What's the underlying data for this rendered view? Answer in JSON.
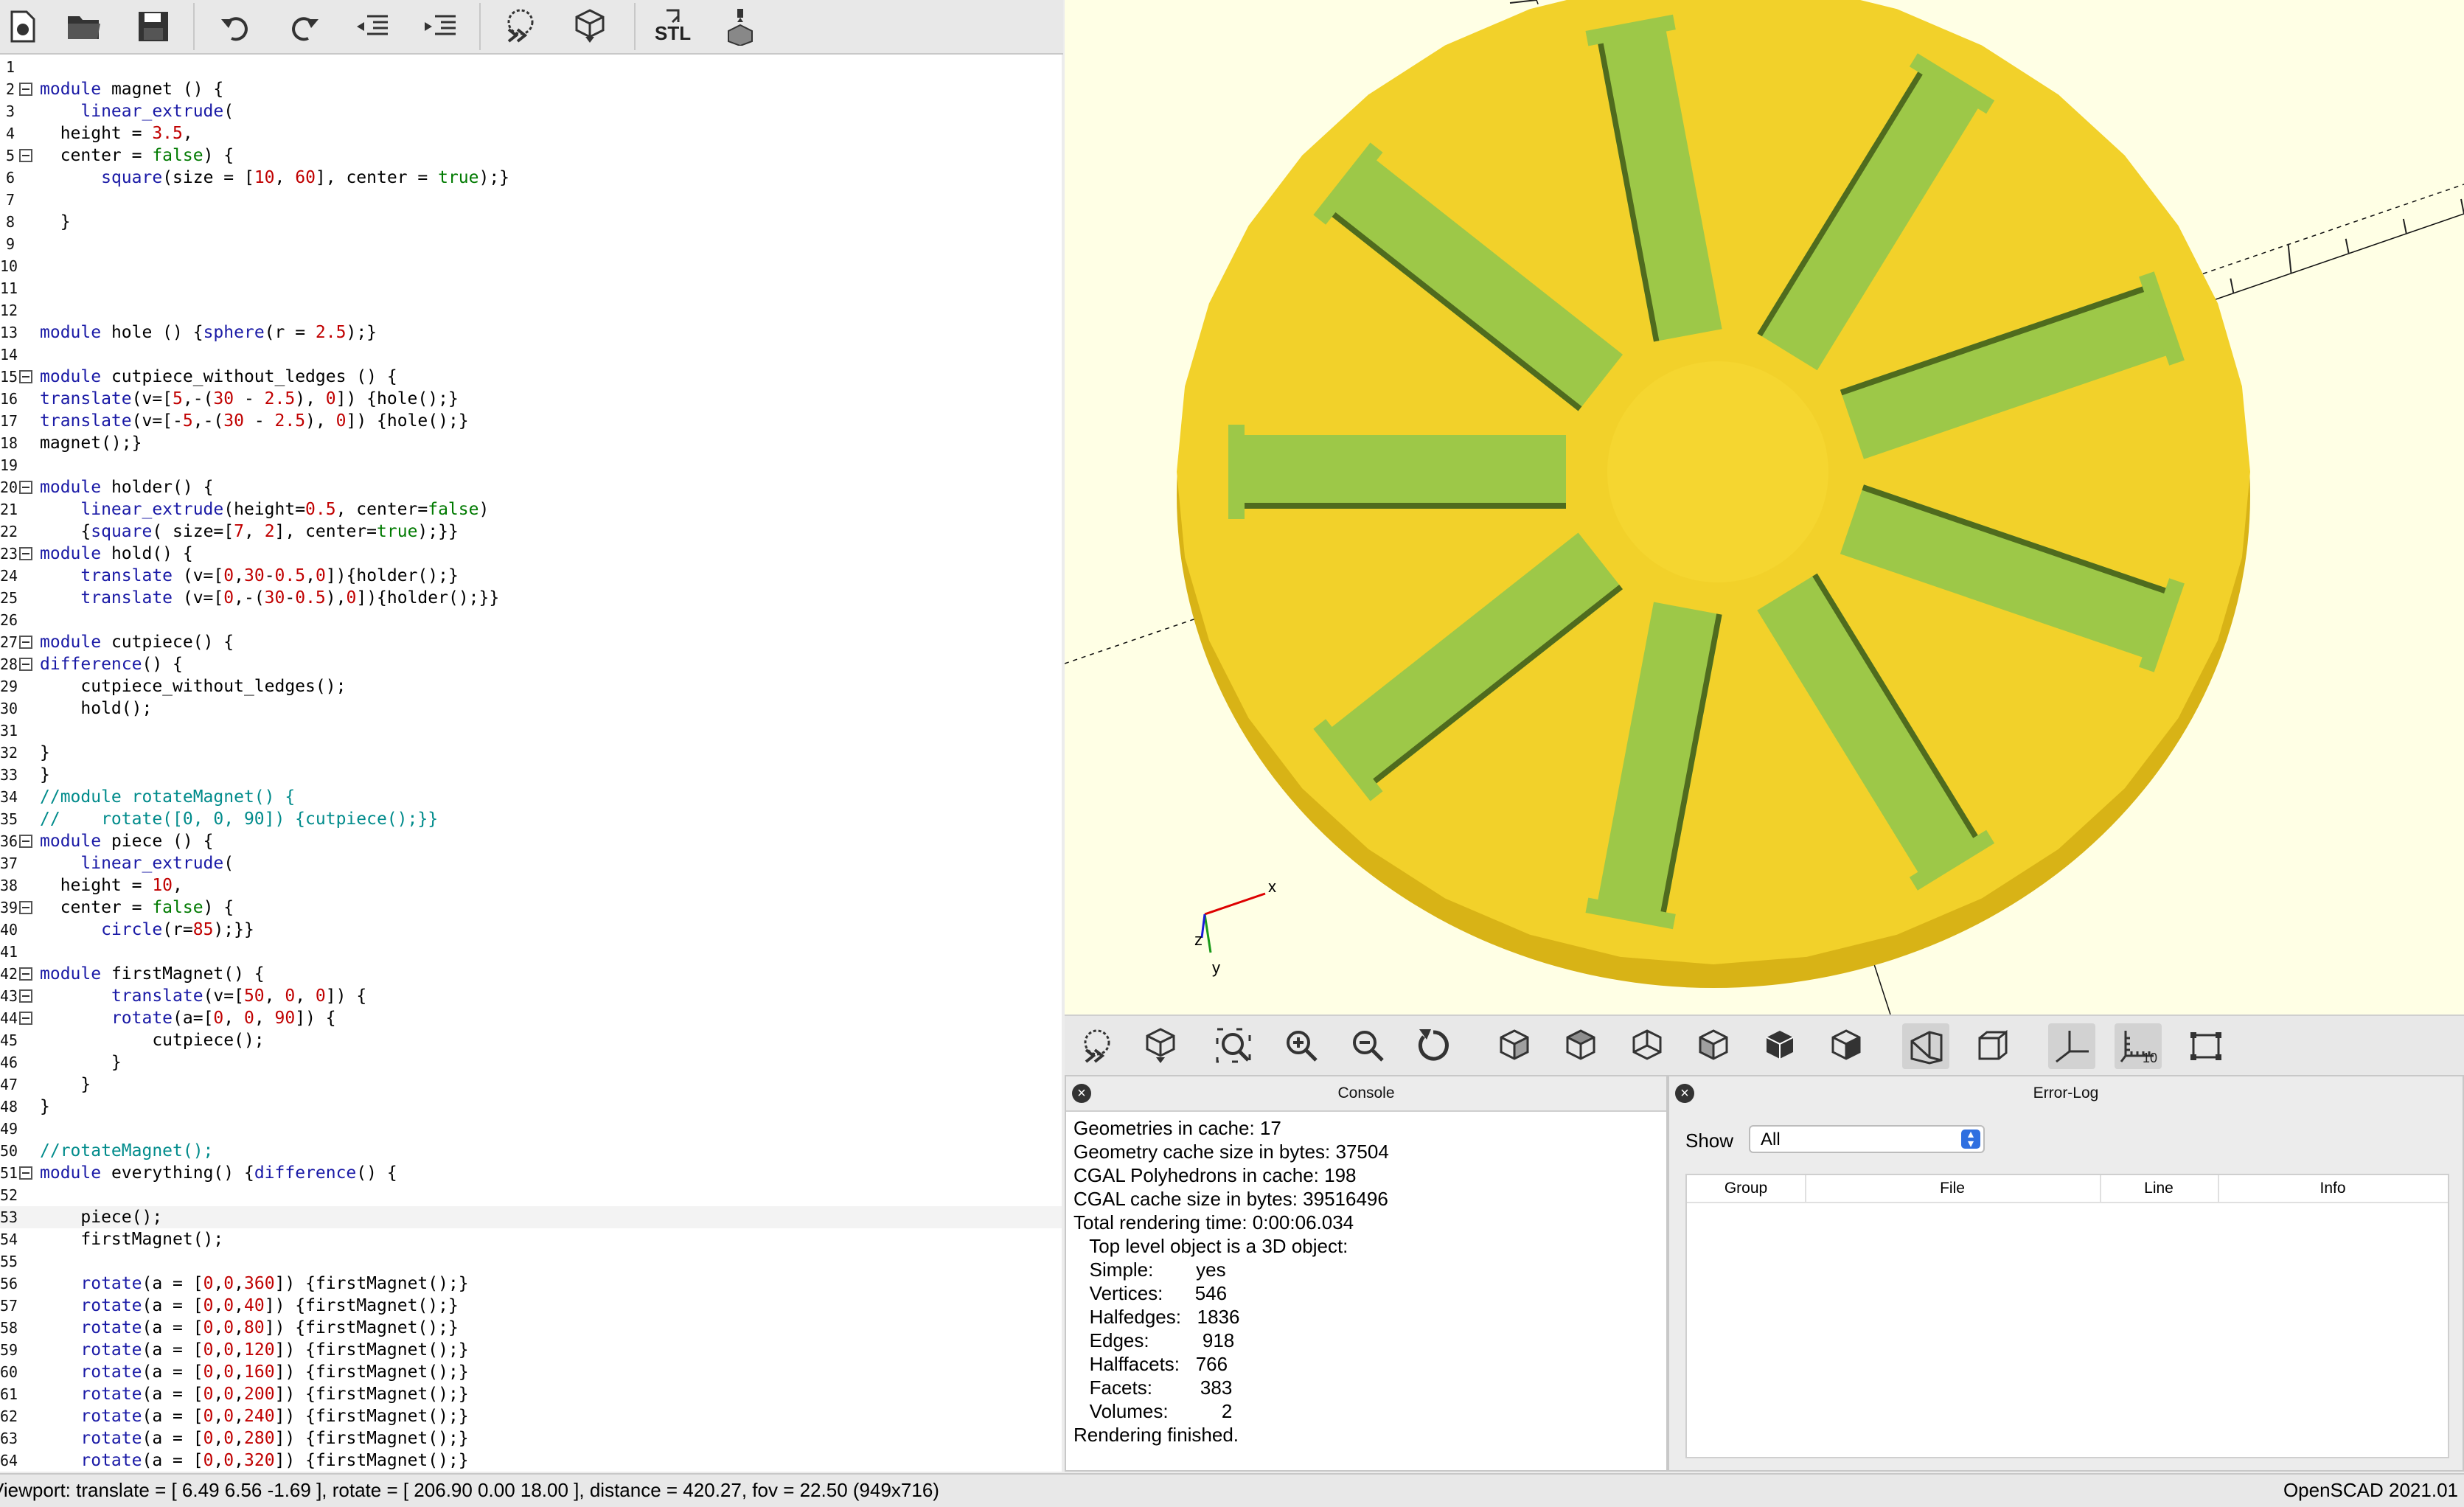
{
  "app": {
    "name_version": "OpenSCAD 2021.01"
  },
  "editor_toolbar": {
    "buttons": [
      "new-file",
      "open-file",
      "save-file",
      "undo",
      "redo",
      "unindent",
      "indent",
      "preview",
      "render",
      "export-stl",
      "send-to-3d-print"
    ],
    "stl_label": "STL"
  },
  "editor": {
    "lines": [
      "",
      "module magnet () {",
      "    linear_extrude(",
      "  height = 3.5,",
      "  center = false) {",
      "      square(size = [10, 60], center = true);}",
      "",
      "  }",
      "",
      "",
      "",
      "",
      "module hole () {sphere(r = 2.5);}",
      "",
      "module cutpiece_without_ledges () {",
      "translate(v=[5,-(30 - 2.5), 0]) {hole();}",
      "translate(v=[-5,-(30 - 2.5), 0]) {hole();}",
      "magnet();}",
      "",
      "module holder() {",
      "    linear_extrude(height=0.5, center=false)",
      "    {square( size=[7, 2], center=true);}}",
      "module hold() {",
      "    translate (v=[0,30-0.5,0]){holder();}",
      "    translate (v=[0,-(30-0.5),0]){holder();}}",
      "",
      "module cutpiece() {",
      "difference() {",
      "    cutpiece_without_ledges();",
      "    hold();",
      "",
      "}",
      "}",
      "//module rotateMagnet() {",
      "//    rotate([0, 0, 90]) {cutpiece();}}",
      "module piece () {",
      "    linear_extrude(",
      "  height = 10,",
      "  center = false) {",
      "      circle(r=85);}}",
      "",
      "module firstMagnet() {",
      "       translate(v=[50, 0, 0]) {",
      "       rotate(a=[0, 0, 90]) {",
      "           cutpiece();",
      "       }",
      "    }",
      "}",
      "",
      "//rotateMagnet();",
      "module everything() {difference() {",
      "",
      "    piece();",
      "    firstMagnet();",
      "",
      "    rotate(a = [0,0,360]) {firstMagnet();}",
      "    rotate(a = [0,0,40]) {firstMagnet();}",
      "    rotate(a = [0,0,80]) {firstMagnet();}",
      "    rotate(a = [0,0,120]) {firstMagnet();}",
      "    rotate(a = [0,0,160]) {firstMagnet();}",
      "    rotate(a = [0,0,200]) {firstMagnet();}",
      "    rotate(a = [0,0,240]) {firstMagnet();}",
      "    rotate(a = [0,0,280]) {firstMagnet();}",
      "    rotate(a = [0,0,320]) {firstMagnet();}"
    ],
    "line_numbers": [
      "1",
      "2",
      "3",
      "4",
      "5",
      "6",
      "7",
      "8",
      "9",
      "10",
      "11",
      "12",
      "13",
      "14",
      "15",
      "16",
      "17",
      "18",
      "19",
      "20",
      "21",
      "22",
      "23",
      "24",
      "25",
      "26",
      "27",
      "28",
      "29",
      "30",
      "31",
      "32",
      "33",
      "34",
      "35",
      "36",
      "37",
      "38",
      "39",
      "40",
      "41",
      "42",
      "43",
      "44",
      "45",
      "46",
      "47",
      "48",
      "49",
      "50",
      "51",
      "52",
      "53",
      "54",
      "55",
      "56",
      "57",
      "58",
      "59",
      "60",
      "61",
      "62",
      "63",
      "64"
    ],
    "fold_markers_at": [
      2,
      5,
      15,
      20,
      23,
      27,
      28,
      36,
      39,
      42,
      43,
      44,
      51
    ],
    "current_line": 53
  },
  "viewport": {
    "colors": {
      "background": "#ffffe5",
      "disk_top": "#f2d12a",
      "disk_side": "#d8b316",
      "slot_floor": "#9dc848",
      "slot_wall": "#4f6b1e"
    },
    "slot_count": 9,
    "slot_rotations_deg": [
      0,
      40,
      80,
      120,
      160,
      200,
      240,
      280,
      320
    ],
    "axis_label_x": "x",
    "axis_label_y": "y",
    "axis_label_z": "z"
  },
  "view_toolbar": {
    "buttons": [
      "preview",
      "render",
      "view-all",
      "zoom-in",
      "zoom-out",
      "reset-view",
      "view-right",
      "view-top",
      "view-bottom",
      "view-left",
      "view-front",
      "view-back",
      "perspective",
      "orthogonal",
      "show-axes",
      "show-scale-markers",
      "show-edges"
    ],
    "scale_marker_label": "10",
    "active": [
      "perspective",
      "show-axes",
      "show-scale-markers"
    ]
  },
  "console": {
    "title": "Console",
    "lines": [
      "Geometries in cache: 17",
      "Geometry cache size in bytes: 37504",
      "CGAL Polyhedrons in cache: 198",
      "CGAL cache size in bytes: 39516496",
      "Total rendering time: 0:00:06.034",
      "   Top level object is a 3D object:",
      "   Simple:        yes",
      "   Vertices:      546",
      "   Halfedges:   1836",
      "   Edges:          918",
      "   Halffacets:   766",
      "   Facets:         383",
      "   Volumes:          2",
      "Rendering finished."
    ]
  },
  "error_log": {
    "title": "Error-Log",
    "show_label": "Show",
    "show_value": "All",
    "columns": [
      "Group",
      "File",
      "Line",
      "Info"
    ]
  },
  "statusbar": {
    "viewport_text": "Viewport: translate = [ 6.49 6.56 -1.69 ], rotate = [ 206.90 0.00 18.00 ], distance = 420.27, fov = 22.50 (949x716)",
    "version": "OpenSCAD 2021.01"
  }
}
